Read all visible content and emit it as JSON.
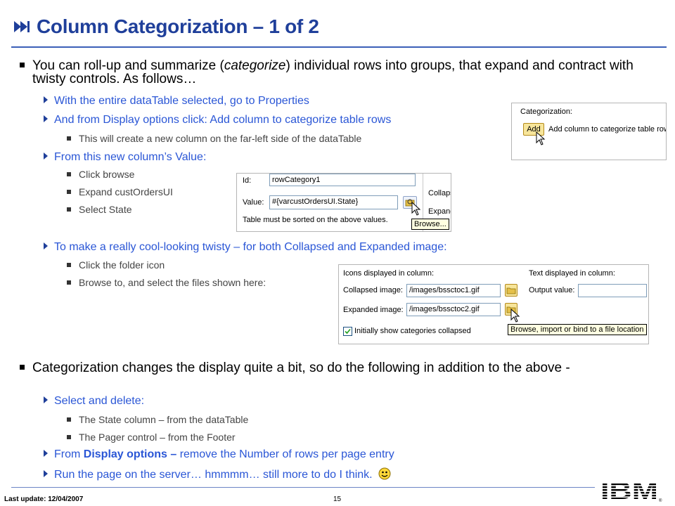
{
  "title": "Column Categorization – 1 of 2",
  "bullets": [
    {
      "text_pre": "You can roll-up and summarize (",
      "text_em": "categorize",
      "text_post": ") individual rows into groups, that expand and contract with twisty controls.  As follows…"
    },
    {
      "text": "Categorization changes the display quite a bit, so do the following in addition to the above -"
    }
  ],
  "sub": {
    "a": "With the entire dataTable selected, go to Properties",
    "b": "And from Display options click: Add column to categorize table rows",
    "b1": "This will create a new column on the far-left side of the dataTable",
    "c": "From this new column’s Value:",
    "c1": "Click browse",
    "c2": "Expand custOrdersUI",
    "c3": "Select State",
    "d": "To make a really cool-looking twisty – for both Collapsed and Expanded image:",
    "d1": "Click the folder icon",
    "d2": "Browse to, and select the files shown here:",
    "e": "Select and delete:",
    "e1": "The State column – from the dataTable",
    "e2": "The Pager control – from the Footer",
    "f_pre": "From ",
    "f_bold": "Display options –",
    "f_post": " remove the Number of rows per page entry",
    "g": "Run the page on the server…  hmmmm…  still more to do I think."
  },
  "shot1": {
    "group_label": "Categorization:",
    "add_button": "Add",
    "add_desc": "Add column to categorize table rows"
  },
  "shot2": {
    "id_label": "Id:",
    "id_value": "rowCategory1",
    "value_label": "Value:",
    "value_value": "#{varcustOrdersUI.State}",
    "note": "Table must be sorted on the above values.",
    "right_top": "Collaps",
    "right_bottom": "Expand",
    "tooltip": "Browse..."
  },
  "shot3": {
    "icons_header": "Icons displayed in column:",
    "text_header": "Text displayed in column:",
    "collapsed_label": "Collapsed image:",
    "collapsed_value": "/images/bssctoc1.gif",
    "expanded_label": "Expanded image:",
    "expanded_value": "/images/bssctoc2.gif",
    "output_label": "Output value:",
    "checkbox_label": "Initially show categories collapsed",
    "tooltip": "Browse, import or bind to a file location"
  },
  "footer": {
    "last_update": "Last update: 12/04/2007",
    "page_number": "15",
    "logo": "IBM"
  },
  "colors": {
    "title": "#1f3f9a",
    "sub_bullet": "#2a56d6",
    "rule": "#3b5fb8"
  }
}
